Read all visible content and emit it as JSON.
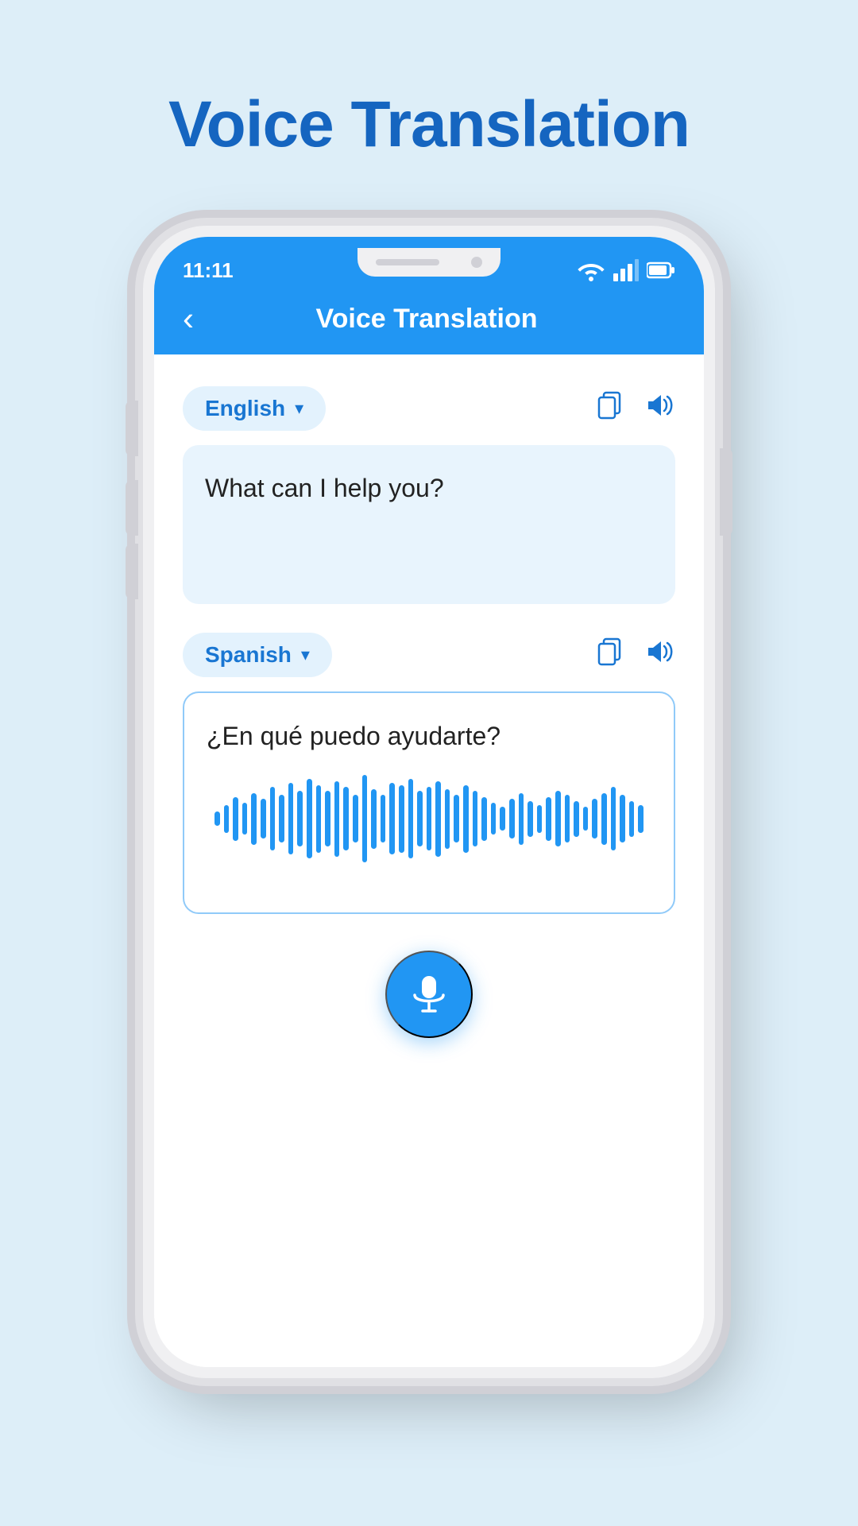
{
  "page": {
    "title": "Voice Translation",
    "background_color": "#ddeef8"
  },
  "status_bar": {
    "time": "11:11",
    "wifi_icon": "wifi",
    "signal_icon": "signal",
    "battery_icon": "battery"
  },
  "header": {
    "back_label": "‹",
    "title": "Voice Translation"
  },
  "english_section": {
    "language": "English",
    "chevron": "▾",
    "copy_icon": "copy",
    "speaker_icon": "speaker",
    "text": "What can I help you?"
  },
  "spanish_section": {
    "language": "Spanish",
    "chevron": "▾",
    "copy_icon": "copy",
    "speaker_icon": "speaker",
    "text": "¿En qué puedo ayudarte?"
  },
  "waveform": {
    "bars": [
      18,
      35,
      55,
      40,
      65,
      50,
      80,
      60,
      90,
      70,
      100,
      85,
      70,
      95,
      80,
      60,
      110,
      75,
      60,
      90,
      85,
      100,
      70,
      80,
      95,
      75,
      60,
      85,
      70,
      55,
      40,
      30,
      50,
      65,
      45,
      35,
      55,
      70,
      60,
      45,
      30,
      50,
      65,
      80,
      60,
      45,
      35
    ]
  },
  "mic_button": {
    "label": "Microphone"
  }
}
